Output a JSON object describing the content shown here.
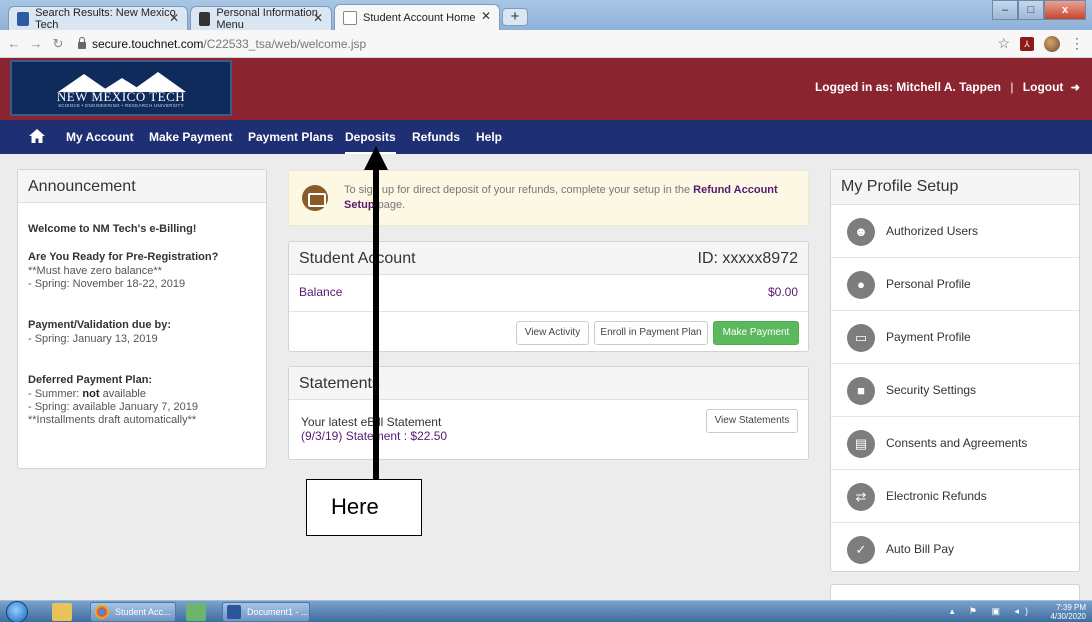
{
  "browser": {
    "tabs": [
      {
        "title": "Search Results: New Mexico Tech"
      },
      {
        "title": "Personal Information Menu"
      },
      {
        "title": "Student Account Home"
      }
    ],
    "new_tab": "+",
    "url_host": "secure.touchnet.com",
    "url_path": "/C22533_tsa/web/welcome.jsp",
    "window_buttons": {
      "minimize": "–",
      "maximize": "□",
      "close": "x"
    }
  },
  "header": {
    "logo_name": "NEW MEXICO TECH",
    "logo_tagline": "SCIENCE • ENGINEERING • RESEARCH UNIVERSITY",
    "logged_in_text": "Logged in as: Mitchell A. Tappen",
    "separator": "|",
    "logout": "Logout"
  },
  "nav": {
    "items": [
      "My Account",
      "Make Payment",
      "Payment Plans",
      "Deposits",
      "Refunds",
      "Help"
    ],
    "active": "Deposits"
  },
  "announcement": {
    "title": "Announcement",
    "welcome": "Welcome to NM Tech's e-Billing!",
    "prereg_title": "Are You Ready for Pre-Registration?",
    "prereg_line1": "**Must have zero balance**",
    "prereg_line2": "- Spring: November 18-22, 2019",
    "payval_title": "Payment/Validation due by:",
    "payval_line1": "- Spring: January 13, 2019",
    "deferred_title": "Deferred Payment Plan:",
    "deferred_line1_pre": "- Summer: ",
    "deferred_line1_bold": "not",
    "deferred_line1_post": " available",
    "deferred_line2": "- Spring: available January 7, 2019",
    "deferred_line3": "**Installments draft automatically**"
  },
  "notice": {
    "text_pre": "To sign up for direct deposit of your refunds, complete your setup in the ",
    "link": "Refund Account Setup",
    "text_post": " page."
  },
  "student_account": {
    "title": "Student Account",
    "id_label": "ID: xxxxx8972",
    "balance_label": "Balance",
    "balance_value": "$0.00",
    "buttons": {
      "view_activity": "View Activity",
      "enroll": "Enroll in Payment Plan",
      "make_payment": "Make Payment"
    }
  },
  "statements": {
    "title": "Statements",
    "latest_label": "Your latest eBill Statement",
    "latest_value": "(9/3/19) Statement :   $22.50",
    "view_button": "View Statements"
  },
  "profile": {
    "title": "My Profile Setup",
    "items": [
      {
        "label": "Authorized Users",
        "icon": "users-icon"
      },
      {
        "label": "Personal Profile",
        "icon": "user-icon"
      },
      {
        "label": "Payment Profile",
        "icon": "credit-card-icon"
      },
      {
        "label": "Security Settings",
        "icon": "lock-icon"
      },
      {
        "label": "Consents and Agreements",
        "icon": "document-icon"
      },
      {
        "label": "Electronic Refunds",
        "icon": "refresh-icon"
      },
      {
        "label": "Auto Bill Pay",
        "icon": "calendar-check-icon"
      }
    ]
  },
  "annotation": {
    "label": "Here"
  },
  "taskbar": {
    "chrome_button": "Student Acc...",
    "word_button": "Document1 - ...",
    "time": "7:39 PM",
    "date": "4/30/2020"
  },
  "colors": {
    "header_red": "#8a2530",
    "nav_navy": "#1e2f74",
    "link_purple": "#551a70",
    "make_payment_green": "#5cb85c"
  }
}
